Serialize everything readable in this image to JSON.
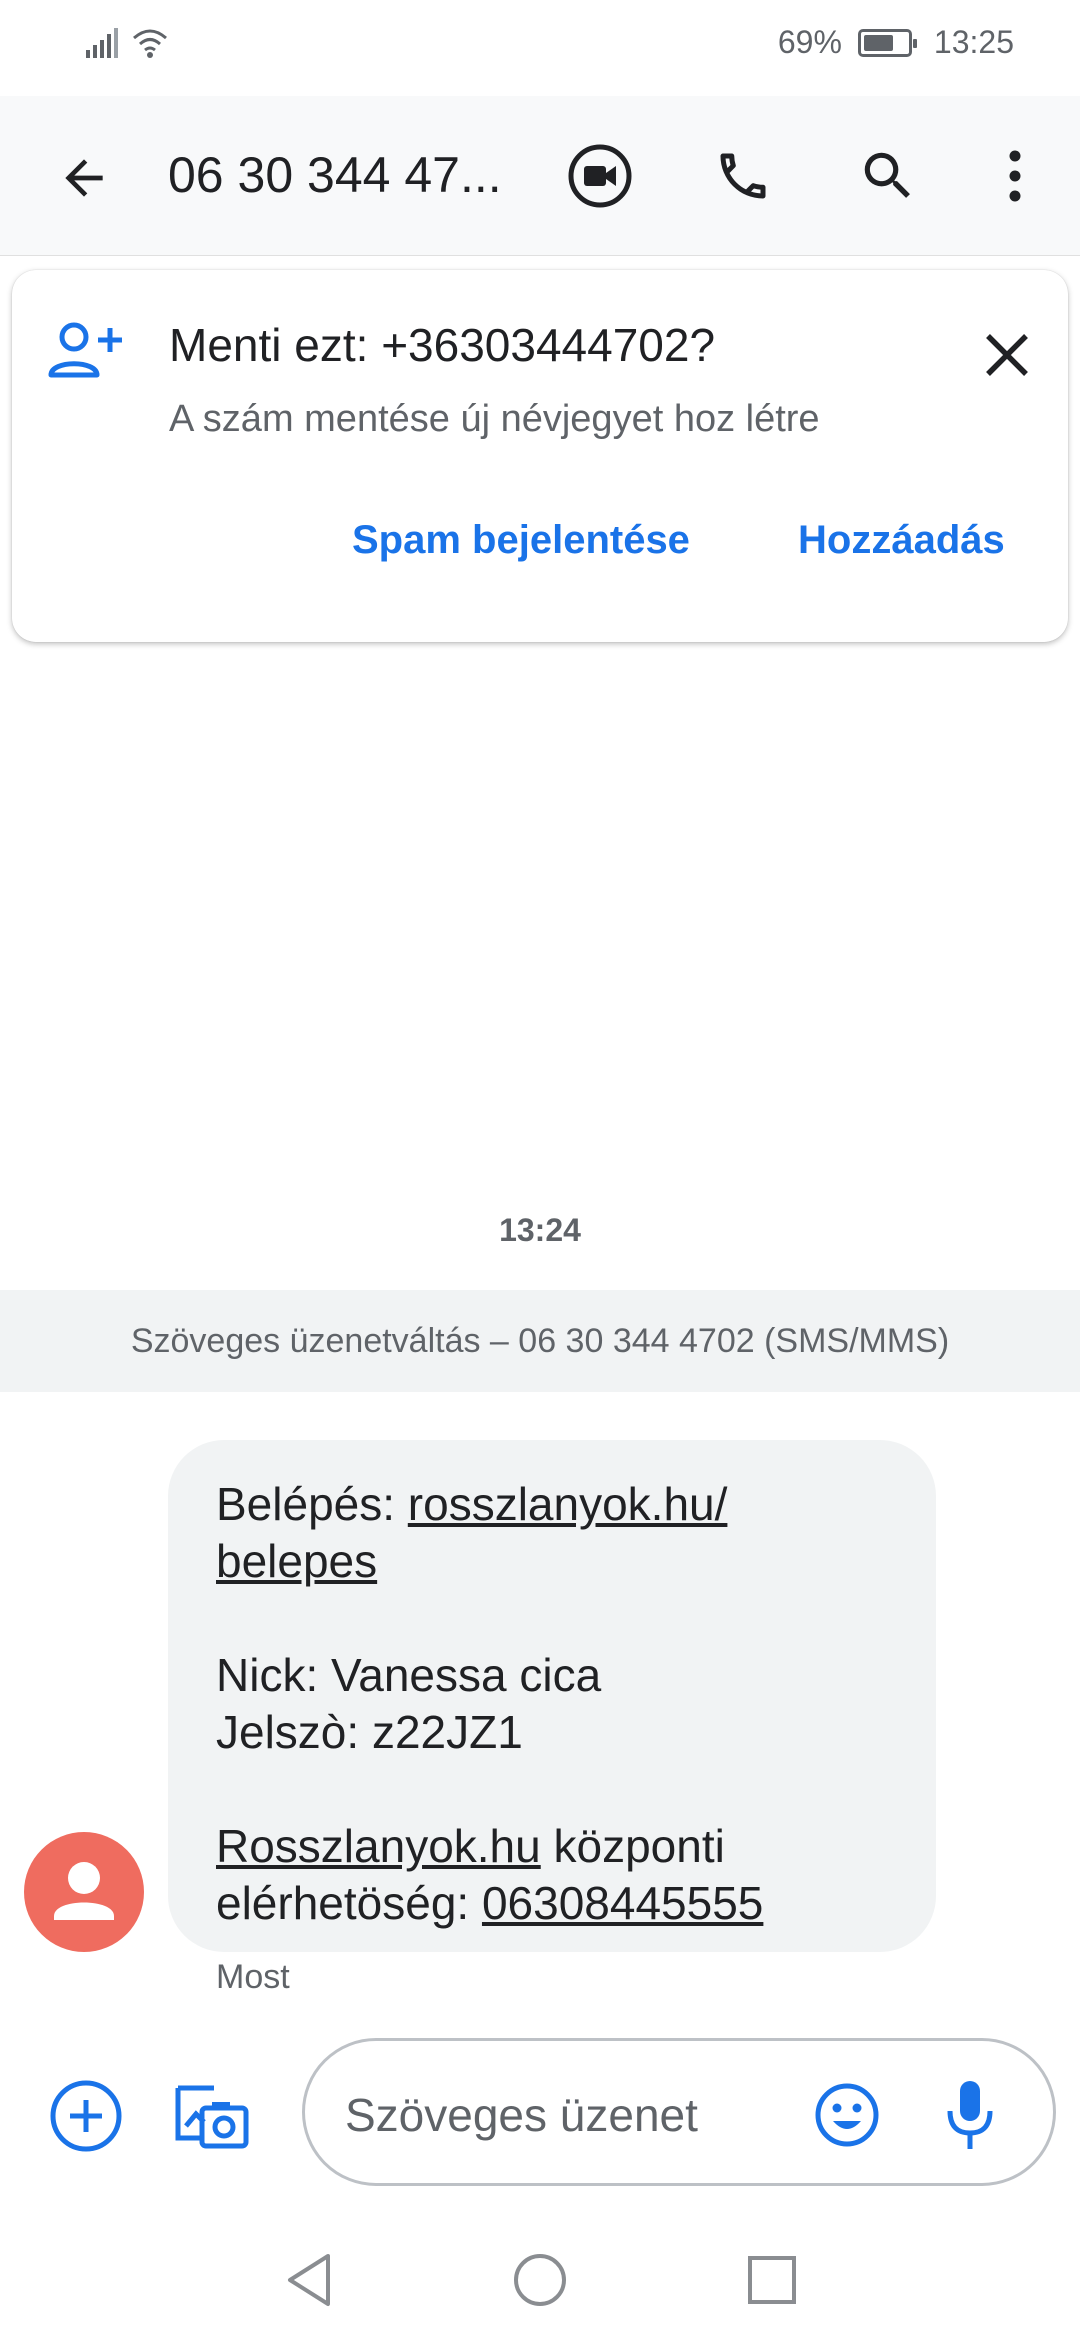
{
  "status_bar": {
    "battery": "69%",
    "battery_level": 0.69,
    "time": "13:25",
    "icons": [
      "signal-icon",
      "wifi-icon",
      "battery-icon"
    ]
  },
  "app_bar": {
    "title": "06 30 344 47...",
    "icons": [
      "back-arrow-icon",
      "video-call-icon",
      "phone-icon",
      "search-icon",
      "more-vert-icon"
    ]
  },
  "save_card": {
    "title": "Menti ezt: +36303444702?",
    "subtitle": "A szám mentése új névjegyet hoz létre",
    "spam_label": "Spam bejelentése",
    "add_label": "Hozzáadás",
    "icons": [
      "person-add-icon",
      "close-icon"
    ]
  },
  "conversation": {
    "time": "13:24",
    "banner": "Szöveges üzenetváltás – 06 30 344 4702 (SMS/MMS)",
    "message": {
      "line1_prefix": "Belépés: ",
      "line1_link": "rosszlanyok.hu/",
      "line2_link": "belepes",
      "line3": "Nick: Vanessa cica",
      "line4": "Jelszò: z22JZ1",
      "line5_link": "Rosszlanyok.hu",
      "line5_suffix": " központi",
      "line6_prefix": "elérhetöség: ",
      "line6_link": "06308445555"
    },
    "message_time": "Most"
  },
  "compose": {
    "placeholder": "Szöveges üzenet",
    "icons": [
      "add-circle-icon",
      "add-photo-icon",
      "emoji-icon",
      "mic-icon"
    ]
  },
  "colors": {
    "accent": "#1a73e8",
    "avatar": "#ef6c5f",
    "bubble": "#f1f3f4"
  }
}
